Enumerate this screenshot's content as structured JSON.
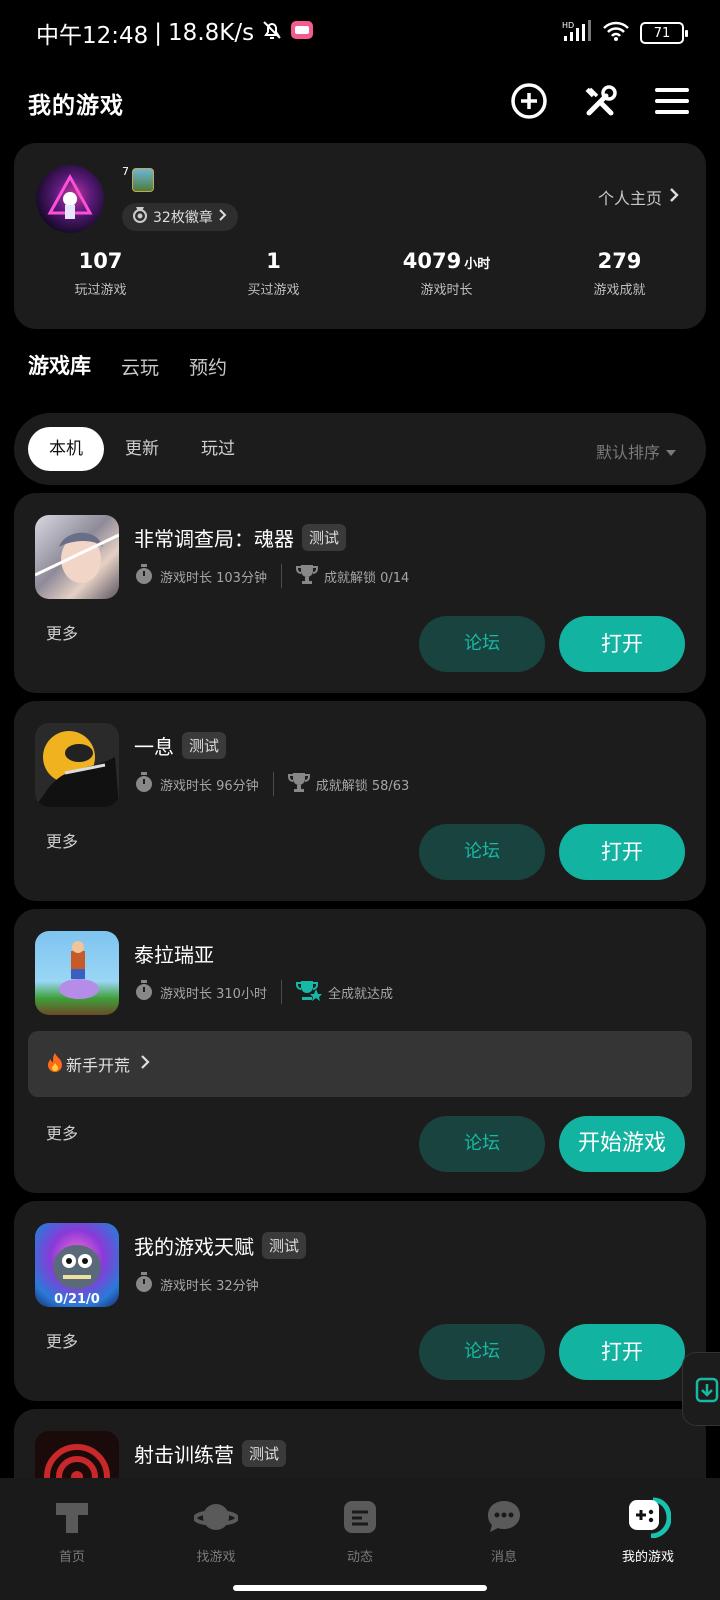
{
  "status_bar": {
    "time": "中午12:48",
    "speed": "18.8K/s",
    "battery": "71",
    "network": "HD"
  },
  "header": {
    "title": "我的游戏"
  },
  "profile": {
    "level": "7",
    "badges": "32枚徽章",
    "homepage": "个人主页",
    "stats": [
      {
        "value": "107",
        "unit": "",
        "label": "玩过游戏"
      },
      {
        "value": "1",
        "unit": "",
        "label": "买过游戏"
      },
      {
        "value": "4079",
        "unit": "小时",
        "label": "游戏时长"
      },
      {
        "value": "279",
        "unit": "",
        "label": "游戏成就"
      }
    ]
  },
  "library_tabs": [
    "游戏库",
    "云玩",
    "预约"
  ],
  "filters": {
    "chips": [
      "本机",
      "更新",
      "玩过"
    ],
    "sort": "默认排序"
  },
  "games": [
    {
      "name": "非常调查局：魂器",
      "tag": "测试",
      "playtime": "游戏时长 103分钟",
      "achievement": "成就解锁 0/14",
      "more": "更多",
      "forum": "论坛",
      "action": "打开"
    },
    {
      "name": "一息",
      "tag": "测试",
      "playtime": "游戏时长 96分钟",
      "achievement": "成就解锁 58/63",
      "more": "更多",
      "forum": "论坛",
      "action": "打开"
    },
    {
      "name": "泰拉瑞亚",
      "tag": "",
      "playtime": "游戏时长 310小时",
      "achievement": "全成就达成",
      "tip": "新手开荒",
      "more": "更多",
      "forum": "论坛",
      "action": "开始游戏"
    },
    {
      "name": "我的游戏天赋",
      "tag": "测试",
      "playtime": "游戏时长 32分钟",
      "icon_text": "0/21/0",
      "more": "更多",
      "forum": "论坛",
      "action": "打开"
    },
    {
      "name": "射击训练营",
      "tag": "测试"
    }
  ],
  "bottom_nav": [
    "首页",
    "找游戏",
    "动态",
    "消息",
    "我的游戏"
  ],
  "colors": {
    "accent": "#12b3a0",
    "card": "#1c1c1c",
    "background": "#000000"
  }
}
